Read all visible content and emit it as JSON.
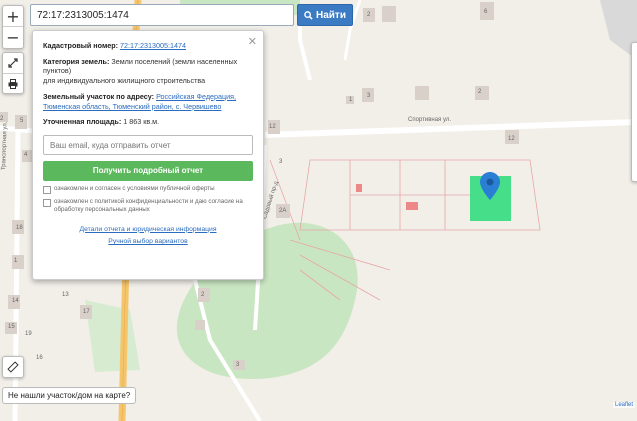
{
  "search": {
    "value": "72:17:2313005:1474",
    "button": "Найти"
  },
  "controls": {
    "zoom_in": "+",
    "zoom_out": "−"
  },
  "popup": {
    "cadastral_label": "Кадастровый номер:",
    "cadastral_value": "72:17:2313005:1474",
    "category_label": "Категория земель:",
    "category_value": "Земли поселений (земли населенных пунктов)",
    "category_use": "для индивидуального жилищного строительства",
    "address_label": "Земельный участок по адресу:",
    "address_value": "Российская Федерация, Тюменская область, Тюменский район, с. Червишево",
    "area_label": "Уточненная площадь:",
    "area_value": "1 863 кв.м.",
    "email_placeholder": "Ваш email, куда отправить отчет",
    "submit": "Получить подробный отчет",
    "check1": "ознакомлен и согласен с условиями публичной оферты",
    "check2": "ознакомлен с политикой конфиденциальности и даю согласие на обработку персональных данных",
    "link1": "Детали отчета и юридическая информация",
    "link2": "Ручной выбор вариантов"
  },
  "map_labels": {
    "street1": "Спортивная ул.",
    "street2": "Транспортная ул.",
    "street3": "Садовый пр-д",
    "houses": [
      "2",
      "6",
      "5",
      "3",
      "1",
      "2",
      "2",
      "13",
      "12",
      "4",
      "2А",
      "12",
      "3",
      "5",
      "18",
      "1",
      "14",
      "13",
      "15",
      "19",
      "17",
      "16",
      "2",
      "3"
    ]
  },
  "bottom_note": "Не нашли участок/дом на карте?",
  "attribution": "Leaflet",
  "colors": {
    "parcel": "#3ddc84",
    "marker": "#2a7fd4",
    "road": "#f5c56b"
  }
}
